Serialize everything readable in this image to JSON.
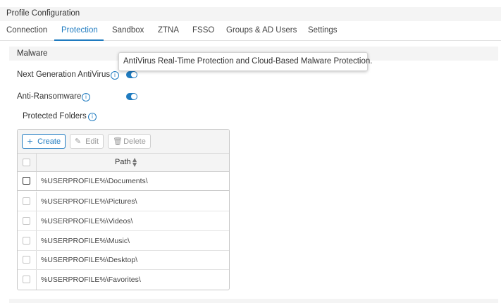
{
  "header": {
    "title": "Profile Configuration"
  },
  "tabs": [
    {
      "label": "Connection"
    },
    {
      "label": "Protection",
      "active": true
    },
    {
      "label": "Sandbox"
    },
    {
      "label": "ZTNA"
    },
    {
      "label": "FSSO"
    },
    {
      "label": "Groups & AD Users"
    },
    {
      "label": "Settings"
    }
  ],
  "section": {
    "title": "Malware"
  },
  "settings": {
    "ngav": {
      "label": "Next Generation AntiVirus",
      "enabled": true
    },
    "anti_ransomware": {
      "label": "Anti-Ransomware",
      "enabled": true
    },
    "protected_folders": {
      "label": "Protected Folders"
    }
  },
  "tooltip": {
    "text": "AntiVirus Real-Time Protection and Cloud-Based Malware Protection."
  },
  "table": {
    "toolbar": {
      "create": "Create",
      "edit": "Edit",
      "delete": "Delete"
    },
    "column_path": "Path",
    "rows": [
      {
        "path": "%USERPROFILE%\\Documents\\"
      },
      {
        "path": "%USERPROFILE%\\Pictures\\"
      },
      {
        "path": "%USERPROFILE%\\Videos\\"
      },
      {
        "path": "%USERPROFILE%\\Music\\"
      },
      {
        "path": "%USERPROFILE%\\Desktop\\"
      },
      {
        "path": "%USERPROFILE%\\Favorites\\"
      }
    ]
  },
  "icons": {
    "info": "info-icon",
    "plus": "plus-icon",
    "pencil": "pencil-icon",
    "trash": "trash-icon",
    "sort": "sort-icon"
  },
  "colors": {
    "accent": "#1f7bc0",
    "toolbar_bg": "#f4f4f4",
    "border": "#c8c8c8"
  }
}
